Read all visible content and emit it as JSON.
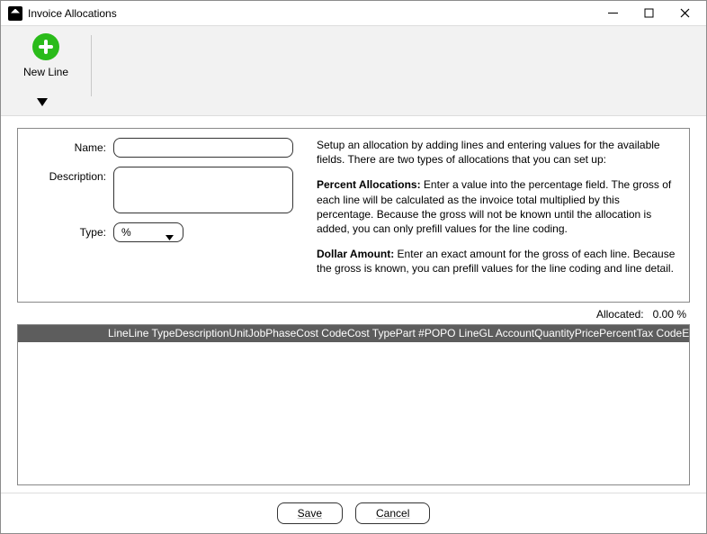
{
  "window": {
    "title": "Invoice Allocations"
  },
  "toolbar": {
    "new_line_label": "New Line"
  },
  "form": {
    "name_label": "Name:",
    "name_value": "",
    "description_label": "Description:",
    "description_value": "",
    "type_label": "Type:",
    "type_value": "%"
  },
  "help": {
    "intro": "Setup an allocation by adding lines and entering values for the available fields. There are two types of allocations that you can set up:",
    "percent_title": "Percent Allocations:",
    "percent_body": " Enter a value into the percentage field. The gross of each line will be calculated as the invoice total multiplied by this percentage. Because the gross will not be known until the allocation is added, you can only prefill values for the line coding.",
    "dollar_title": "Dollar Amount:",
    "dollar_body": " Enter an exact amount for the gross of each line. Because the gross is known, you can prefill values for the line coding and line detail."
  },
  "allocated": {
    "label": "Allocated:",
    "value": "0.00 %"
  },
  "grid": {
    "columns": [
      "Line",
      "Line Type",
      "Description",
      "Unit",
      "Job",
      "Phase",
      "Cost Code",
      "Cost Type",
      "Part #",
      "PO",
      "PO Line",
      "GL Account",
      "Quantity",
      "Price",
      "Percent",
      "Tax Code",
      "Entry Da"
    ]
  },
  "buttons": {
    "save": "Save",
    "cancel": "Cancel"
  }
}
